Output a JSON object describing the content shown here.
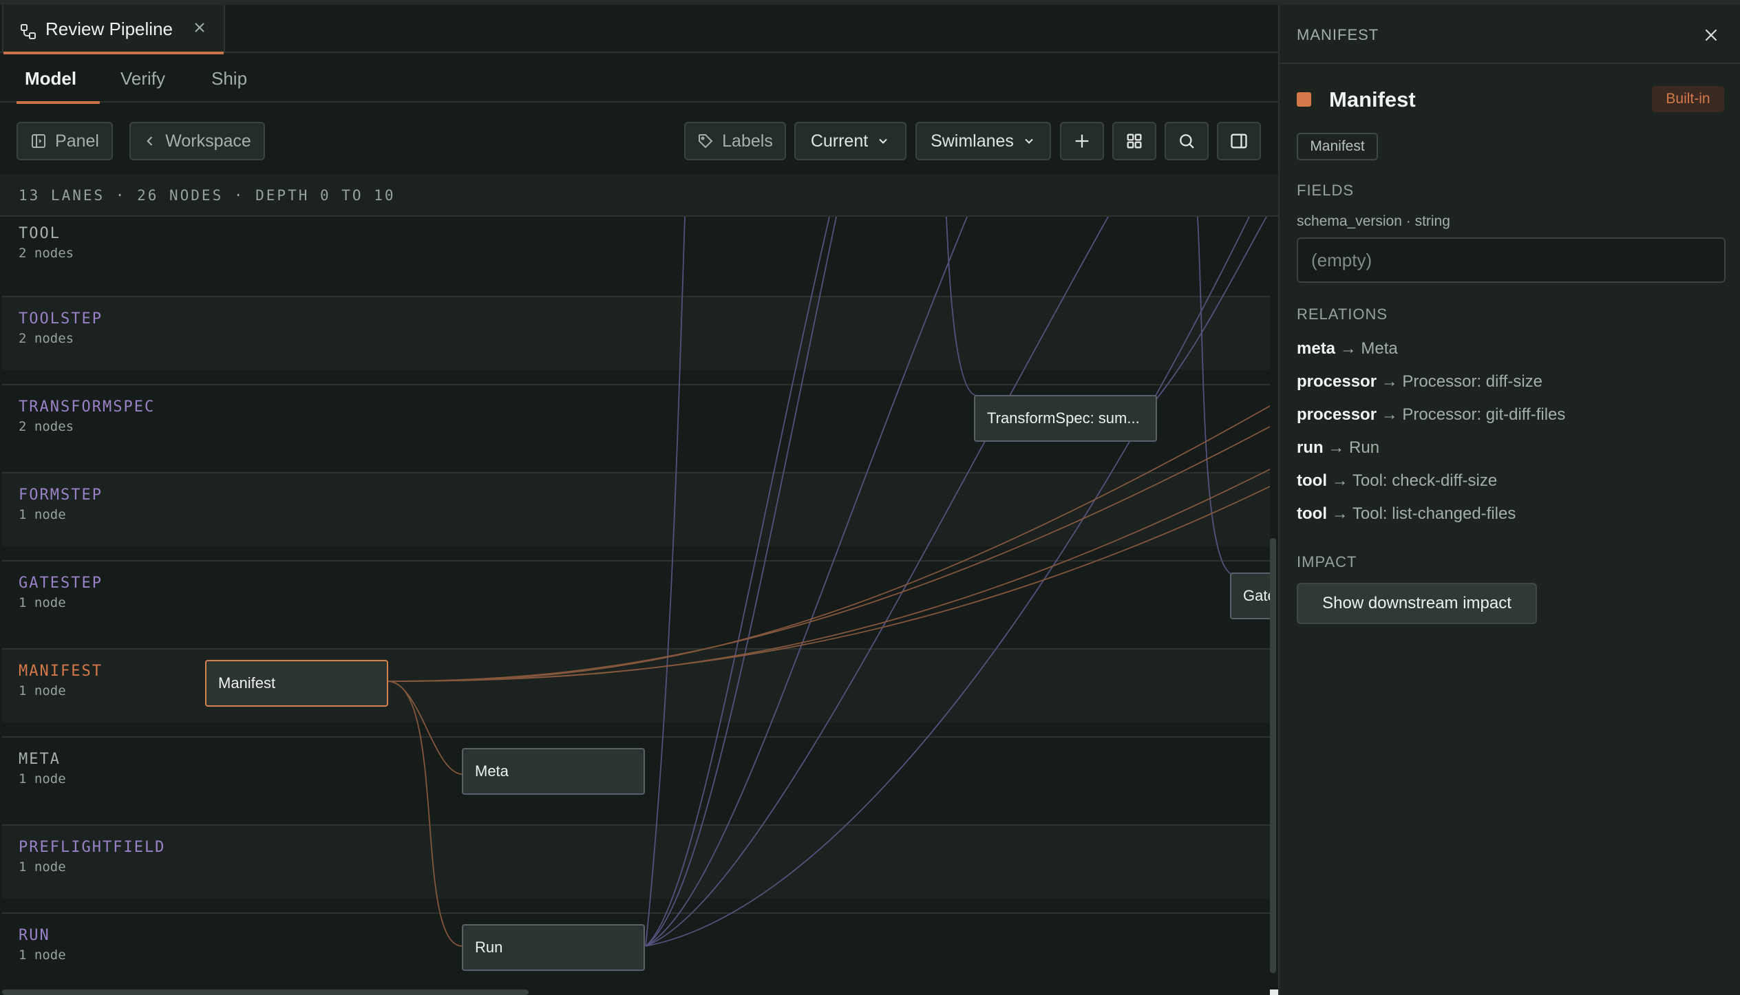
{
  "tab": {
    "title": "Review Pipeline",
    "close_icon": "close-icon",
    "icon": "pipeline-icon"
  },
  "view_tabs": [
    {
      "label": "Model",
      "active": true
    },
    {
      "label": "Verify",
      "active": false
    },
    {
      "label": "Ship",
      "active": false
    }
  ],
  "toolbar": {
    "panel": "Panel",
    "workspace": "Workspace",
    "labels": "Labels",
    "version_select": "Current",
    "layout_select": "Swimlanes"
  },
  "stats": "13 LANES · 26 NODES · DEPTH 0 TO 10",
  "lanes": [
    {
      "name": "TOOL",
      "count": "2 nodes",
      "color": "#a7b0aa"
    },
    {
      "name": "TOOLSTEP",
      "count": "2 nodes",
      "color": "#9a82c9"
    },
    {
      "name": "TRANSFORMSPEC",
      "count": "2 nodes",
      "color": "#9a82c9"
    },
    {
      "name": "FORMSTEP",
      "count": "1 node",
      "color": "#9a82c9"
    },
    {
      "name": "GATESTEP",
      "count": "1 node",
      "color": "#9a82c9"
    },
    {
      "name": "MANIFEST",
      "count": "1 node",
      "color": "#d5784a"
    },
    {
      "name": "META",
      "count": "1 node",
      "color": "#a7b0aa"
    },
    {
      "name": "PREFLIGHTFIELD",
      "count": "1 node",
      "color": "#9a82c9"
    },
    {
      "name": "RUN",
      "count": "1 node",
      "color": "#9a82c9"
    }
  ],
  "nodes": {
    "transformspec": "TransformSpec: sum...",
    "gatestep": "Gate",
    "manifest": "Manifest",
    "meta": "Meta",
    "run": "Run"
  },
  "inspector": {
    "header": "MANIFEST",
    "title": "Manifest",
    "builtin_badge": "Built-in",
    "tag": "Manifest",
    "accent": "#d5784a",
    "fields_heading": "FIELDS",
    "field_name": "schema_version · string",
    "field_placeholder": "(empty)",
    "relations_heading": "RELATIONS",
    "relations": [
      {
        "key": "meta",
        "target": "Meta"
      },
      {
        "key": "processor",
        "target": "Processor: diff-size"
      },
      {
        "key": "processor",
        "target": "Processor: git-diff-files"
      },
      {
        "key": "run",
        "target": "Run"
      },
      {
        "key": "tool",
        "target": "Tool: check-diff-size"
      },
      {
        "key": "tool",
        "target": "Tool: list-changed-files"
      }
    ],
    "impact_heading": "IMPACT",
    "impact_button": "Show downstream impact"
  }
}
